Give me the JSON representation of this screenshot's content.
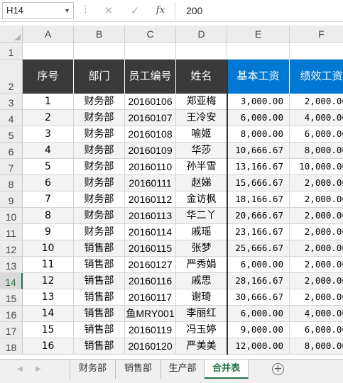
{
  "formula_bar": {
    "name_box": "H14",
    "dots": "⋮",
    "cancel_icon": "✕",
    "confirm_icon": "✓",
    "fx_label": "fx",
    "content": "200"
  },
  "columns": [
    "A",
    "B",
    "C",
    "D",
    "E",
    "F"
  ],
  "row_numbers": [
    "1",
    "2",
    "3",
    "4",
    "5",
    "6",
    "7",
    "8",
    "9",
    "10",
    "11",
    "12",
    "13",
    "14",
    "15",
    "16",
    "17",
    "18"
  ],
  "selected_row": "14",
  "table": {
    "headers": [
      "序号",
      "部门",
      "员工编号",
      "姓名",
      "基本工资",
      "绩效工资"
    ],
    "rows": [
      [
        "1",
        "财务部",
        "20160106",
        "郑亚梅",
        "3,000.00",
        "2,000.00"
      ],
      [
        "2",
        "财务部",
        "20160107",
        "王冷安",
        "6,000.00",
        "4,000.00"
      ],
      [
        "3",
        "财务部",
        "20160108",
        "喻姬",
        "8,000.00",
        "6,000.00"
      ],
      [
        "4",
        "财务部",
        "20160109",
        "华莎",
        "10,666.67",
        "8,000.00"
      ],
      [
        "5",
        "财务部",
        "20160110",
        "孙半雪",
        "13,166.67",
        "10,000.00"
      ],
      [
        "6",
        "财务部",
        "20160111",
        "赵娣",
        "15,666.67",
        "2,000.00"
      ],
      [
        "7",
        "财务部",
        "20160112",
        "金访枫",
        "18,166.67",
        "2,000.00"
      ],
      [
        "8",
        "财务部",
        "20160113",
        "华二丫",
        "20,666.67",
        "2,000.00"
      ],
      [
        "9",
        "财务部",
        "20160114",
        "戚瑶",
        "23,166.67",
        "2,000.00"
      ],
      [
        "10",
        "销售部",
        "20160115",
        "张梦",
        "25,666.67",
        "2,000.00"
      ],
      [
        "11",
        "销售部",
        "20160127",
        "严秀娟",
        "6,000.00",
        "2,000.00"
      ],
      [
        "12",
        "销售部",
        "20160116",
        "戚思",
        "28,166.67",
        "2,000.00"
      ],
      [
        "13",
        "销售部",
        "20160117",
        "谢琦",
        "30,666.67",
        "2,000.00"
      ],
      [
        "14",
        "销售部",
        "鱼MRY001",
        "李丽红",
        "6,000.00",
        "4,000.00"
      ],
      [
        "15",
        "销售部",
        "20160119",
        "冯玉婷",
        "9,000.00",
        "6,000.00"
      ],
      [
        "16",
        "销售部",
        "20160120",
        "严美美",
        "12,000.00",
        "8,000.00"
      ]
    ]
  },
  "sheet_tabs": [
    "财务部",
    "销售部",
    "生产部",
    "合并表"
  ],
  "active_tab": "合并表",
  "add_sheet_icon": "+",
  "nav_prev_icon": "◀",
  "nav_next_icon": "▶",
  "colors": {
    "header_dark": "#3a3a3a",
    "header_blue": "#0078d4",
    "accent_green": "#217346"
  }
}
